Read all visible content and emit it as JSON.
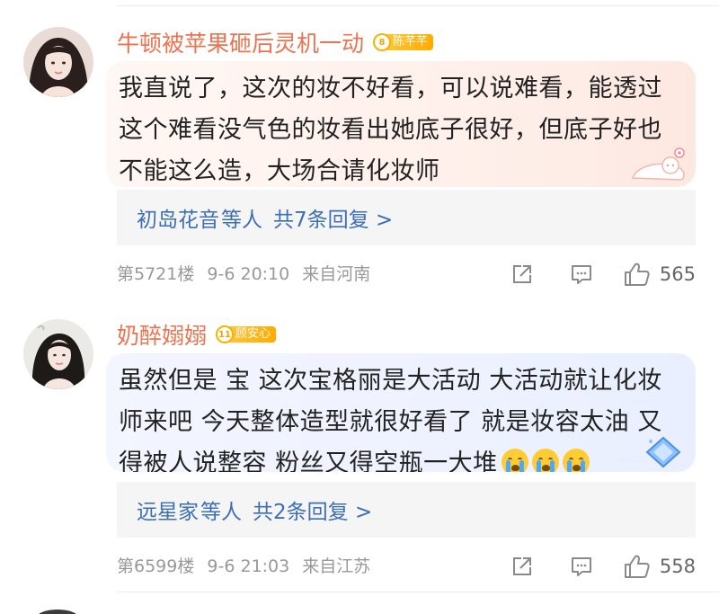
{
  "comments": [
    {
      "username": "牛顿被苹果砸后灵机一动",
      "badge_level": "8",
      "badge_name": "陈芊芊",
      "content": "我直说了，这次的妆不好看，可以说难看，能透过这个难看没气色的妆看出她底子很好，但底子好也不能这么造，大场合请化妆师",
      "reply_names": "初岛花音",
      "reply_suffix": "等人",
      "reply_count": "共7条回复 >",
      "floor": "第5721楼",
      "time": "9-6 20:10",
      "location": "来自河南",
      "likes": "565",
      "bubble_decoration": "cat-decoration"
    },
    {
      "username": "奶醉嫋嫋",
      "badge_level": "11",
      "badge_name": "顾安心",
      "content": "虽然但是 宝 这次宝格丽是大活动 大活动就让化妆师来吧 今天整体造型就很好看了 就是妆容太油 又得被人说整容 粉丝又得空瓶一大堆",
      "emojis": [
        "crying-emoji",
        "crying-emoji",
        "crying-emoji"
      ],
      "reply_names": "远星家",
      "reply_suffix": "等人",
      "reply_count": "共2条回复 >",
      "floor": "第6599楼",
      "time": "9-6 21:03",
      "location": "来自江苏",
      "likes": "558",
      "bubble_decoration": "diamond-decoration"
    }
  ],
  "icons": {
    "share": "share-icon",
    "comment": "comment-icon",
    "like": "thumbs-up-icon"
  },
  "colors": {
    "username": "#eb7350",
    "link": "#3d6fb6",
    "meta": "#999999",
    "badge": "#ffb400"
  }
}
